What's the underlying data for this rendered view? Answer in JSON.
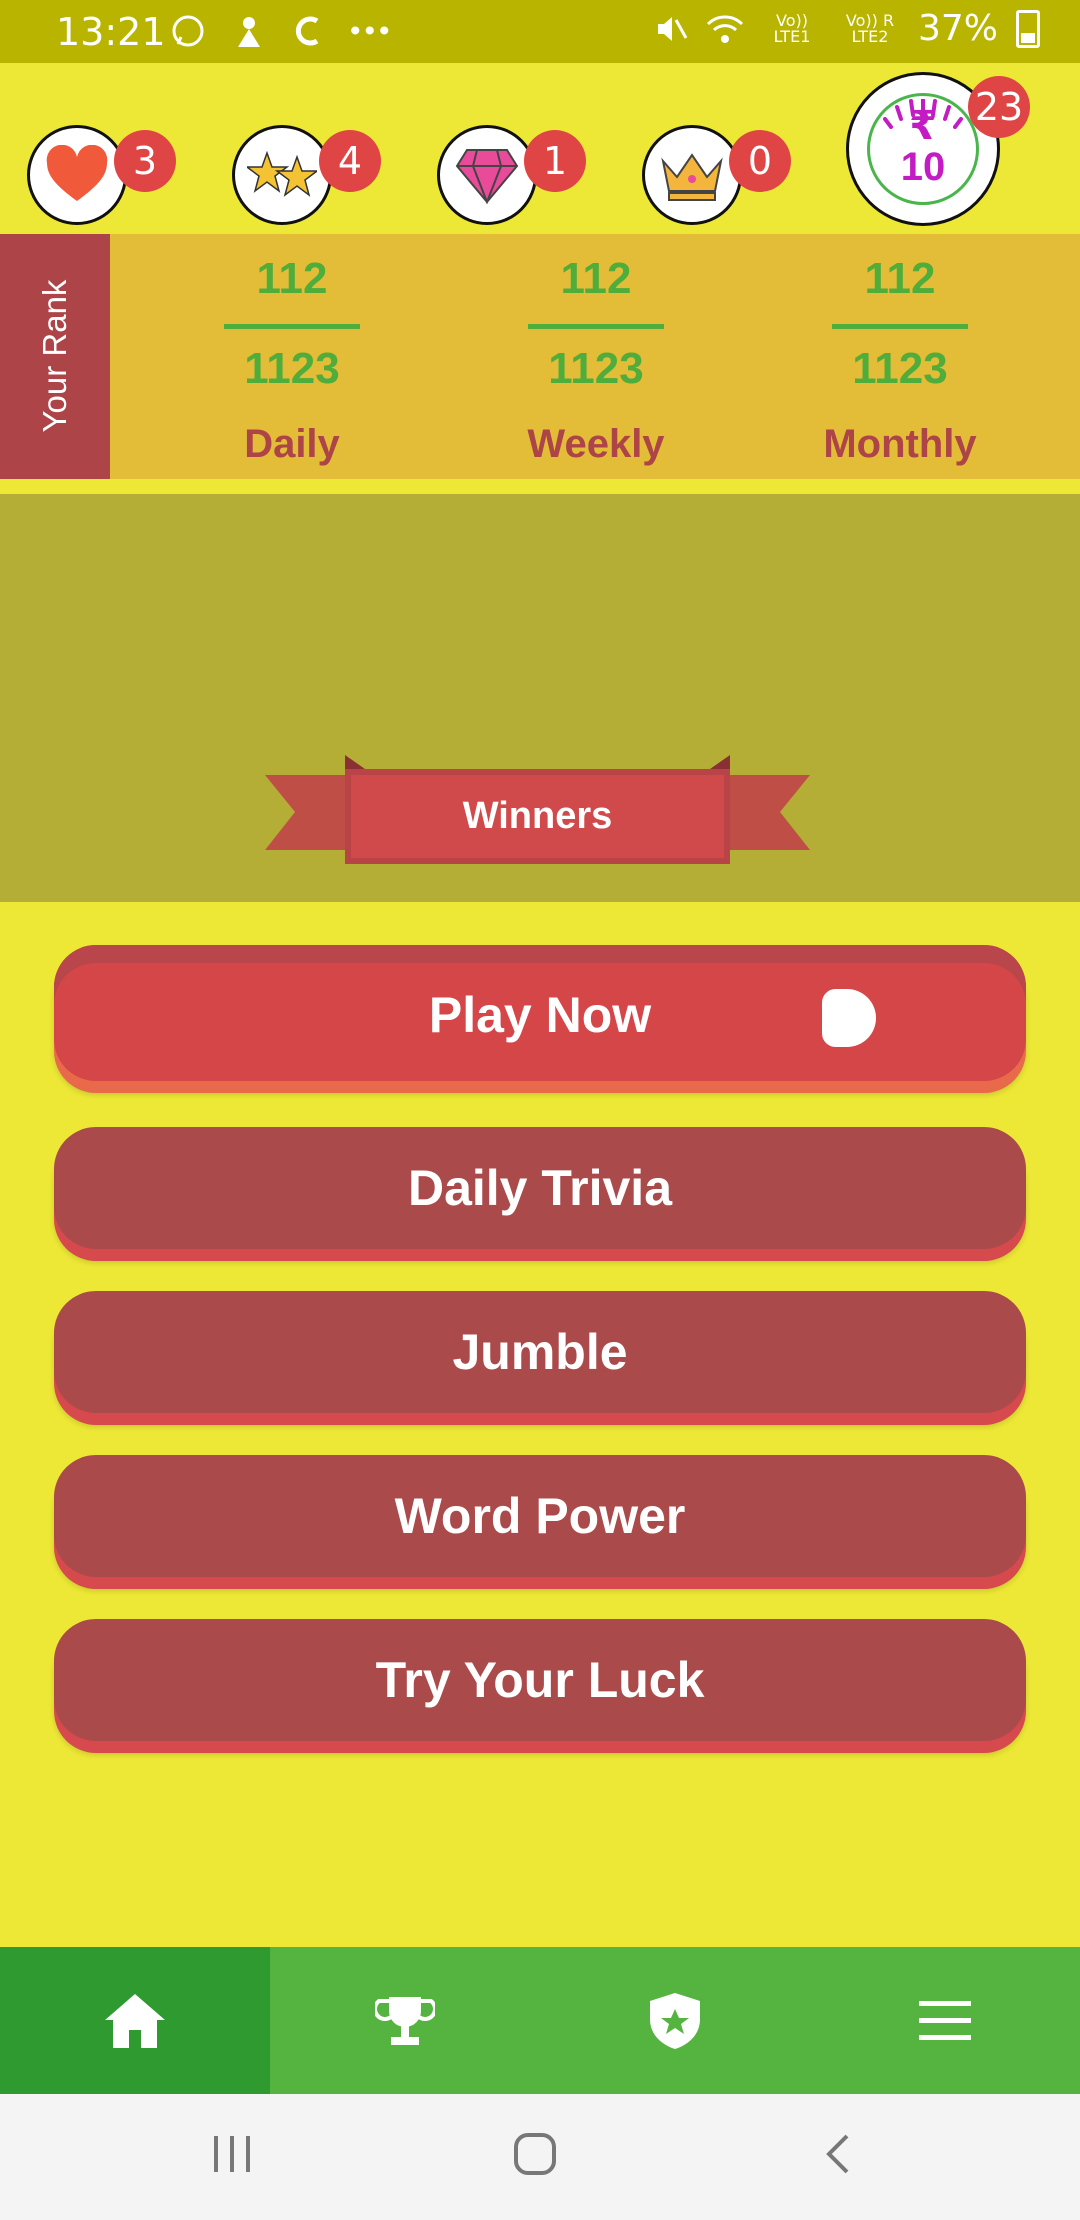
{
  "status_bar": {
    "time": "13:21",
    "battery": "37%",
    "sim1": "Vo)) LTE1",
    "sim2": "Vo)) R LTE2"
  },
  "stats": [
    {
      "icon": "heart-icon",
      "count": "3"
    },
    {
      "icon": "stars-icon",
      "count": "4"
    },
    {
      "icon": "diamond-icon",
      "count": "1"
    },
    {
      "icon": "crown-icon",
      "count": "0"
    }
  ],
  "coin": {
    "symbol": "₹",
    "value": "10",
    "count": "23"
  },
  "rank": {
    "label": "Your Rank",
    "periods": [
      {
        "top": "112",
        "bottom": "1123",
        "label": "Daily"
      },
      {
        "top": "112",
        "bottom": "1123",
        "label": "Weekly"
      },
      {
        "top": "112",
        "bottom": "1123",
        "label": "Monthly"
      }
    ]
  },
  "banner": {
    "label": "Winners"
  },
  "buttons": {
    "play_now": "Play Now",
    "daily_trivia": "Daily Trivia",
    "jumble": "Jumble",
    "word_power": "Word Power",
    "try_your_luck": "Try Your Luck"
  },
  "bottom_nav": [
    "home-icon",
    "trophy-icon",
    "badge-icon",
    "menu-icon"
  ],
  "colors": {
    "background": "#ede836",
    "status_bar": "#b8b400",
    "rank_bg": "#e3bd38",
    "rank_accent": "#ad4448",
    "rank_numbers": "#4fad3b",
    "button": "#ab4a4b",
    "play_button": "#d54649",
    "nav": "#55b43f",
    "nav_active": "#2f9a2f"
  }
}
